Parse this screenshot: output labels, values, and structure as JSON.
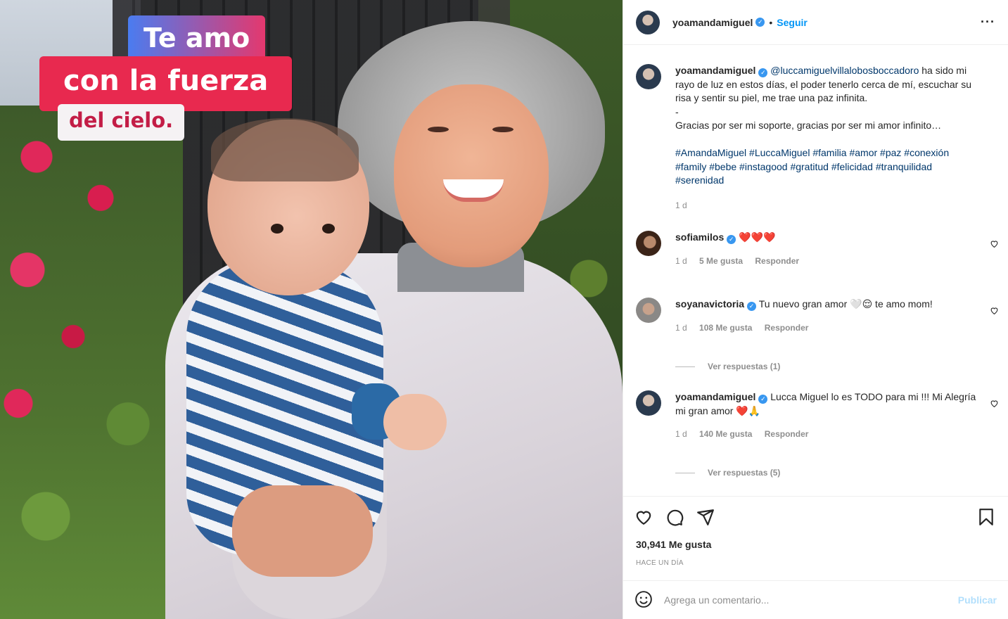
{
  "photo": {
    "overlay_line1": "Te amo",
    "overlay_line2": "con la fuerza",
    "overlay_line3": "del cielo."
  },
  "header": {
    "username": "yoamandamiguel",
    "separator": "•",
    "follow_label": "Seguir",
    "more_icon": "more-options-icon"
  },
  "caption": {
    "username": "yoamandamiguel",
    "mention": "@luccamiguelvillalobosboccadoro",
    "text_1": " ha sido mi rayo de luz en estos días, el poder tenerlo cerca de mí, escuchar su risa y sentir su piel, me trae una paz infinita.",
    "dash": "-",
    "text_2": "Gracias por ser mi soporte, gracias por ser mi amor infinito…",
    "hashtags": "#AmandaMiguel #LuccaMiguel #familia #amor #paz #conexión #family #bebe #instagood #gratitud #felicidad #tranquilidad #serenidad",
    "time": "1 d"
  },
  "comments": [
    {
      "username": "sofiamilos",
      "text": "❤️❤️❤️",
      "time": "1 d",
      "likes": "5 Me gusta",
      "reply": "Responder"
    },
    {
      "username": "soyanavictoria",
      "text": "Tu nuevo gran amor 🤍😌 te amo mom!",
      "time": "1 d",
      "likes": "108 Me gusta",
      "reply": "Responder",
      "view_replies": "Ver respuestas (1)"
    },
    {
      "username": "yoamandamiguel",
      "text": "Lucca Miguel lo es TODO para mi !!! Mi Alegría mi gran amor ❤️🙏",
      "time": "1 d",
      "likes": "140 Me gusta",
      "reply": "Responder",
      "view_replies": "Ver respuestas (5)"
    }
  ],
  "footer": {
    "likes": "30,941 Me gusta",
    "ago": "HACE UN DÍA",
    "comment_placeholder": "Agrega un comentario...",
    "post_label": "Publicar"
  },
  "colors": {
    "link": "#00376b",
    "follow": "#0095f6",
    "verified": "#3897f0",
    "post_disabled": "#b2dffc"
  }
}
